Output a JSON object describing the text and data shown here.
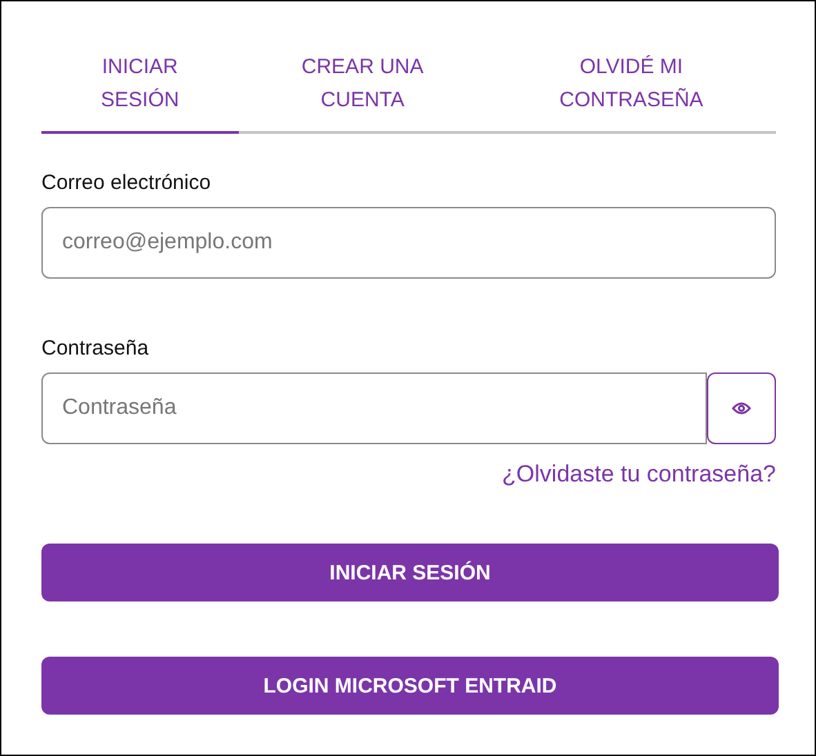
{
  "tabs": [
    {
      "label": "INICIAR SESIÓN",
      "selected": true
    },
    {
      "label": "CREAR UNA CUENTA",
      "selected": false
    },
    {
      "label": "OLVIDÉ MI CONTRASEÑA",
      "selected": false
    }
  ],
  "fields": [
    {
      "label": "Correo electrónico",
      "placeholder": "correo@ejemplo.com",
      "kind": "email"
    },
    {
      "label": "Contraseña",
      "placeholder": "Contraseña",
      "kind": "password"
    }
  ],
  "forgot_link": "¿Olvidaste tu contraseña?",
  "buttons": [
    "INICIAR SESIÓN",
    "LOGIN MICROSOFT ENTRAID"
  ]
}
